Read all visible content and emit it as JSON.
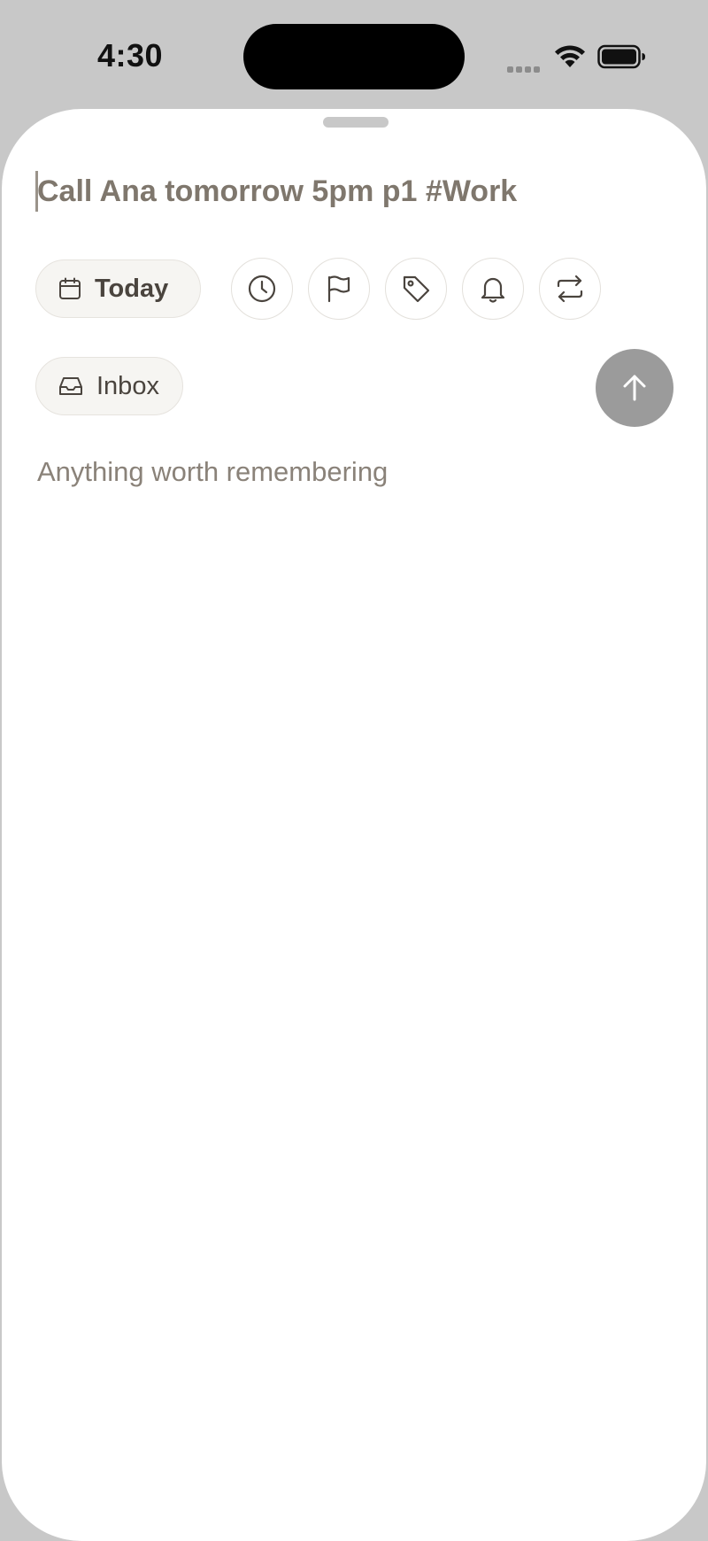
{
  "status_bar": {
    "time": "4:30"
  },
  "task_input": {
    "value": "Call Ana tomorrow 5pm p1 #Work"
  },
  "quick_actions": {
    "date_label": "Today",
    "buttons": [
      "clock-icon",
      "flag-icon",
      "tag-icon",
      "bell-icon",
      "repeat-icon"
    ]
  },
  "project": {
    "label": "Inbox"
  },
  "description": {
    "placeholder": "Anything worth remembering"
  },
  "colors": {
    "sheet_background": "#ffffff",
    "backdrop": "#c8c8c8",
    "title_text": "#7f776d",
    "send_button": "#9b9b9b",
    "chip_background": "#f6f5f2"
  }
}
